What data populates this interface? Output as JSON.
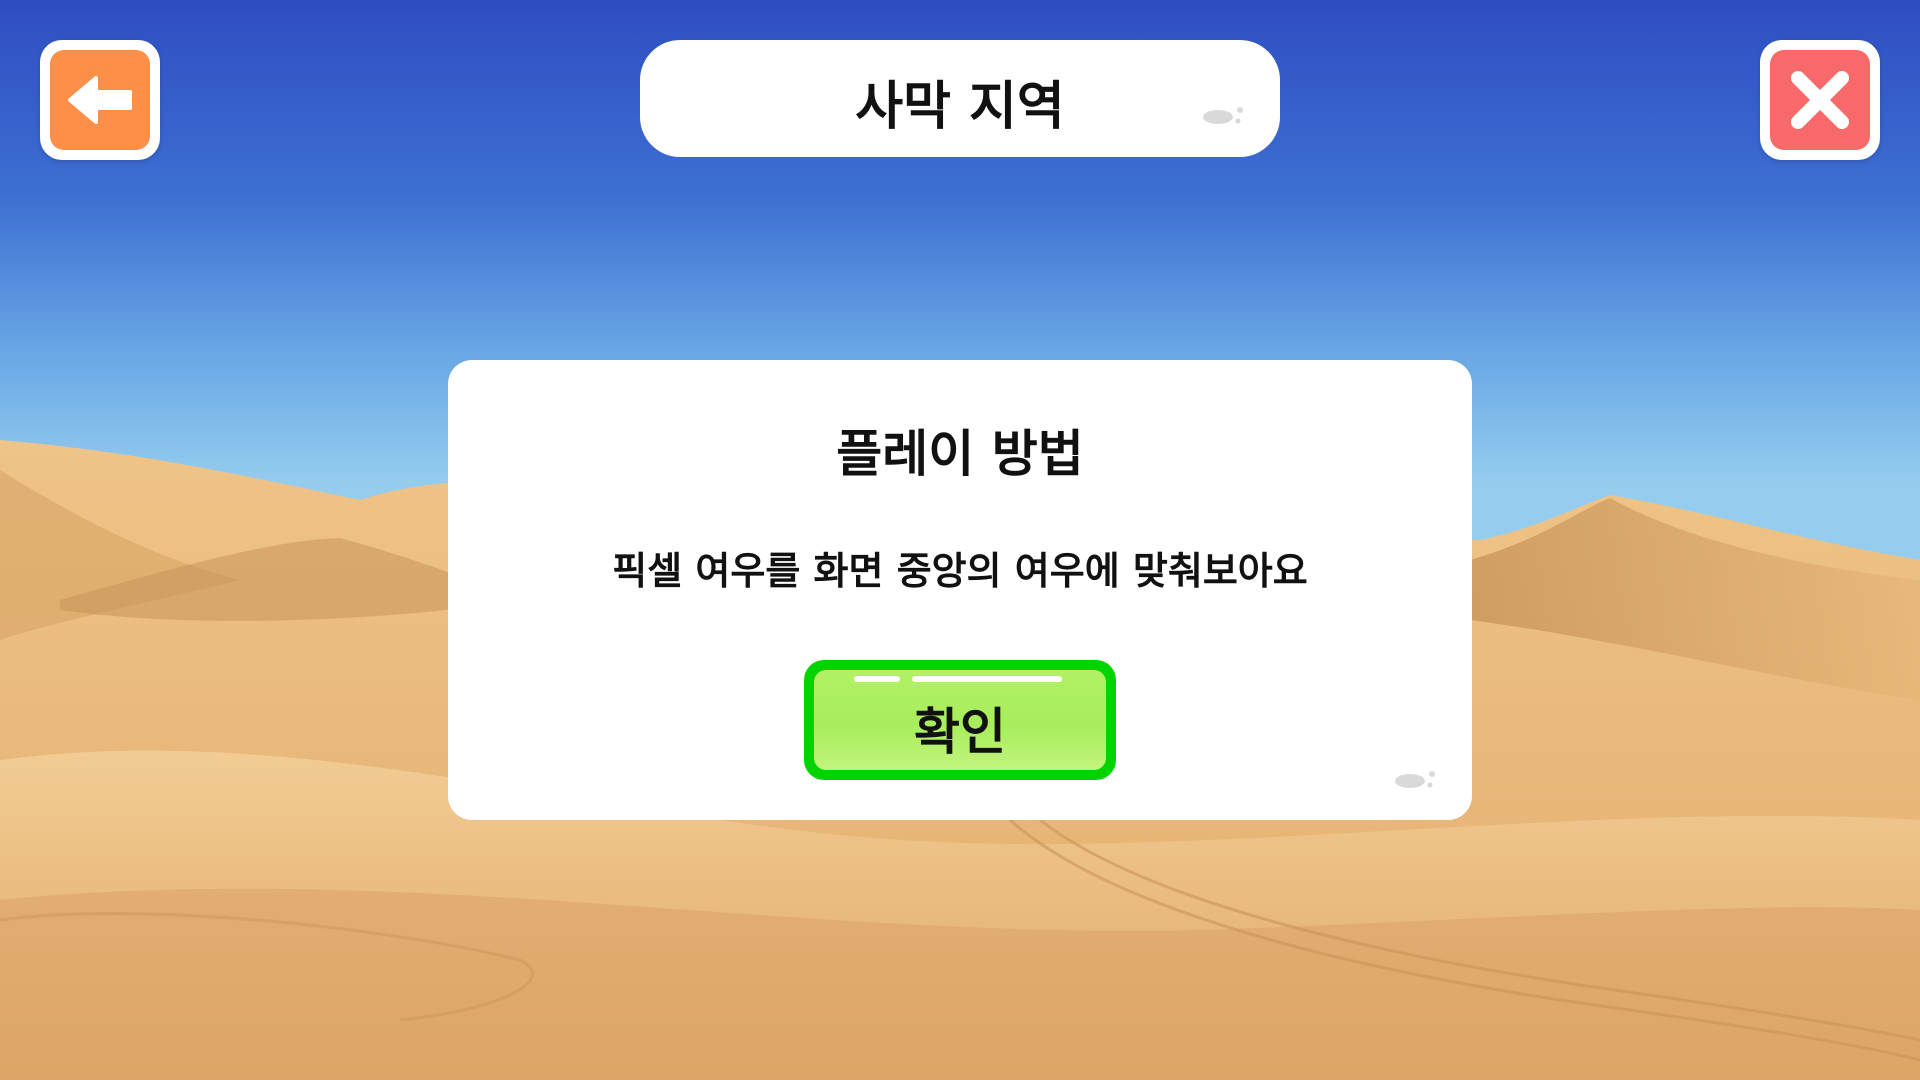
{
  "header": {
    "title": "사막 지역",
    "back_icon": "arrow-left-icon",
    "close_icon": "close-x-icon"
  },
  "dialog": {
    "title": "플레이 방법",
    "message": "픽셀 여우를 화면 중앙의 여우에 맞춰보아요",
    "confirm_label": "확인"
  },
  "colors": {
    "back_button": "#fd8f48",
    "close_button": "#f8696b",
    "confirm_border": "#00d400",
    "confirm_fill": "#aaee5f",
    "sky_top": "#2f4fc4",
    "sky_horizon": "#8cc8ee",
    "sand": "#e8b778"
  }
}
